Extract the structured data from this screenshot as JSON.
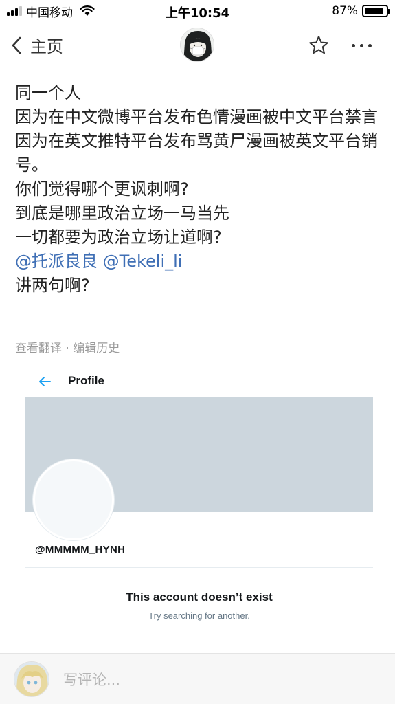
{
  "status_bar": {
    "carrier": "中国移动",
    "time": "上午10:54",
    "battery": "87%",
    "battery_level": 0.87,
    "signal_bars": 3,
    "icons": [
      "signal-icon",
      "wifi-icon",
      "battery-icon"
    ]
  },
  "nav": {
    "back_label": "主页",
    "icons": [
      "back-arrow-icon",
      "star-icon",
      "more-icon"
    ]
  },
  "post": {
    "lines": [
      "同一个人",
      "因为在中文微博平台发布色情漫画被中文平台禁言",
      "因为在英文推特平台发布骂黄尸漫画被英文平台销号。",
      "你们觉得哪个更讽刺啊?",
      "到底是哪里政治立场一马当先",
      "一切都要为政治立场让道啊?"
    ],
    "mentions": [
      "@托派良良",
      "@Tekeli_li"
    ],
    "last_line": "讲两句啊?",
    "meta": {
      "translate": "查看翻译",
      "separator": "·",
      "edit_history": "编辑历史"
    }
  },
  "embed": {
    "title": "Profile",
    "handle": "@MMMMM_HYNH",
    "message": "This account doesn’t exist",
    "sub_message": "Try searching for another.",
    "banner_color": "#ccd6dd",
    "accent_color": "#1da1f2"
  },
  "comment_bar": {
    "placeholder": "写评论..."
  }
}
